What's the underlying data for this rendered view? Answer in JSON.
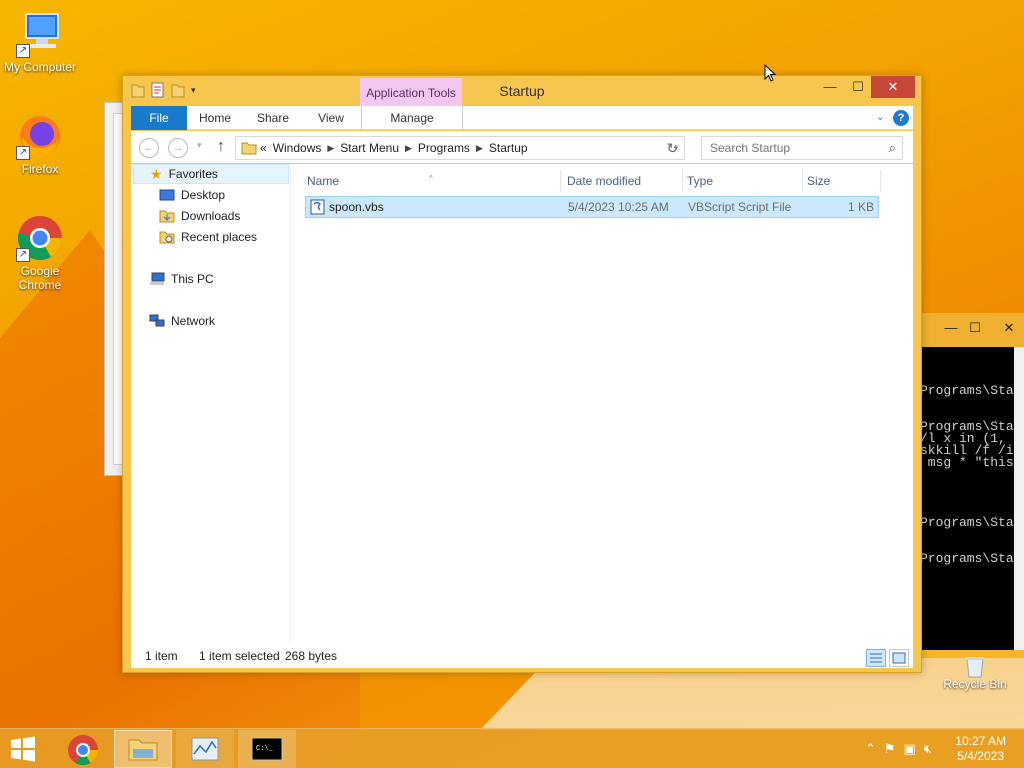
{
  "desktop": {
    "icons": [
      {
        "label": "My Computer"
      },
      {
        "label": "Firefox"
      },
      {
        "label": "Google Chrome"
      }
    ],
    "recycle_bin": "Recycle Bin"
  },
  "explorer": {
    "title": "Startup",
    "contextual_tab_group": "Application Tools",
    "ribbon_tabs": {
      "file": "File",
      "home": "Home",
      "share": "Share",
      "view": "View",
      "manage": "Manage"
    },
    "breadcrumb": {
      "overflow": "«",
      "items": [
        "Windows",
        "Start Menu",
        "Programs",
        "Startup"
      ]
    },
    "search": {
      "placeholder": "Search Startup"
    },
    "nav_pane": {
      "favorites": "Favorites",
      "desktop": "Desktop",
      "downloads": "Downloads",
      "recent": "Recent places",
      "this_pc": "This PC",
      "network": "Network"
    },
    "columns": {
      "name": "Name",
      "date": "Date modified",
      "type": "Type",
      "size": "Size"
    },
    "files": [
      {
        "name": "spoon.vbs",
        "date": "5/4/2023 10:25 AM",
        "type": "VBScript Script File",
        "size": "1 KB",
        "selected": true
      }
    ],
    "status": {
      "count": "1 item",
      "selected": "1 item selected",
      "bytes": "268 bytes"
    }
  },
  "console": {
    "lines": [
      "Programs\\Sta",
      "Programs\\Sta",
      "/l x in (1,",
      "skkill /f /i",
      " msg * \"this",
      "Programs\\Sta",
      "Programs\\Sta"
    ]
  },
  "taskbar": {
    "clock_time": "10:27 AM",
    "clock_date": "5/4/2023"
  },
  "colors": {
    "accent": "#1979ca",
    "selection": "#cce8ff",
    "close": "#c7473a",
    "window_frame": "#f6c64f"
  }
}
